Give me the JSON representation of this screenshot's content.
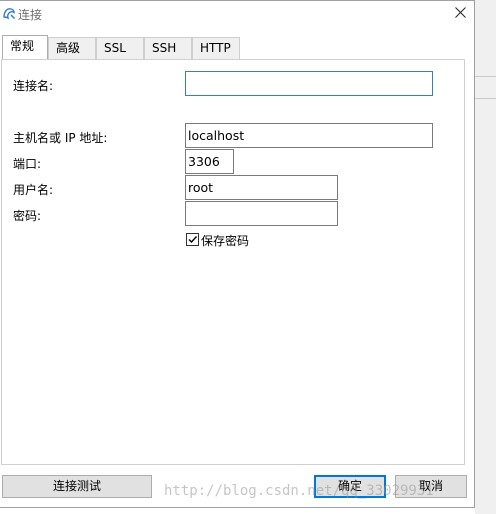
{
  "window": {
    "title": "连接",
    "close_glyph": "✕"
  },
  "tabs": [
    {
      "label": "常规",
      "active": true
    },
    {
      "label": "高级",
      "active": false
    },
    {
      "label": "SSL",
      "active": false
    },
    {
      "label": "SSH",
      "active": false
    },
    {
      "label": "HTTP",
      "active": false
    }
  ],
  "form": {
    "connection_name": {
      "label": "连接名:",
      "value": ""
    },
    "host": {
      "label": "主机名或 IP 地址:",
      "value": "localhost"
    },
    "port": {
      "label": "端口:",
      "value": "3306"
    },
    "username": {
      "label": "用户名:",
      "value": "root"
    },
    "password": {
      "label": "密码:",
      "value": ""
    },
    "save_password": {
      "label": "保存密码",
      "checked": true
    }
  },
  "buttons": {
    "test": "连接测试",
    "ok": "确定",
    "cancel": "取消"
  },
  "watermark": "http://blog.csdn.net/qq_33029931",
  "colors": {
    "accent": "#0078d7",
    "focus_border": "#3c7fb1",
    "app_icon": "#2f7fc1"
  }
}
